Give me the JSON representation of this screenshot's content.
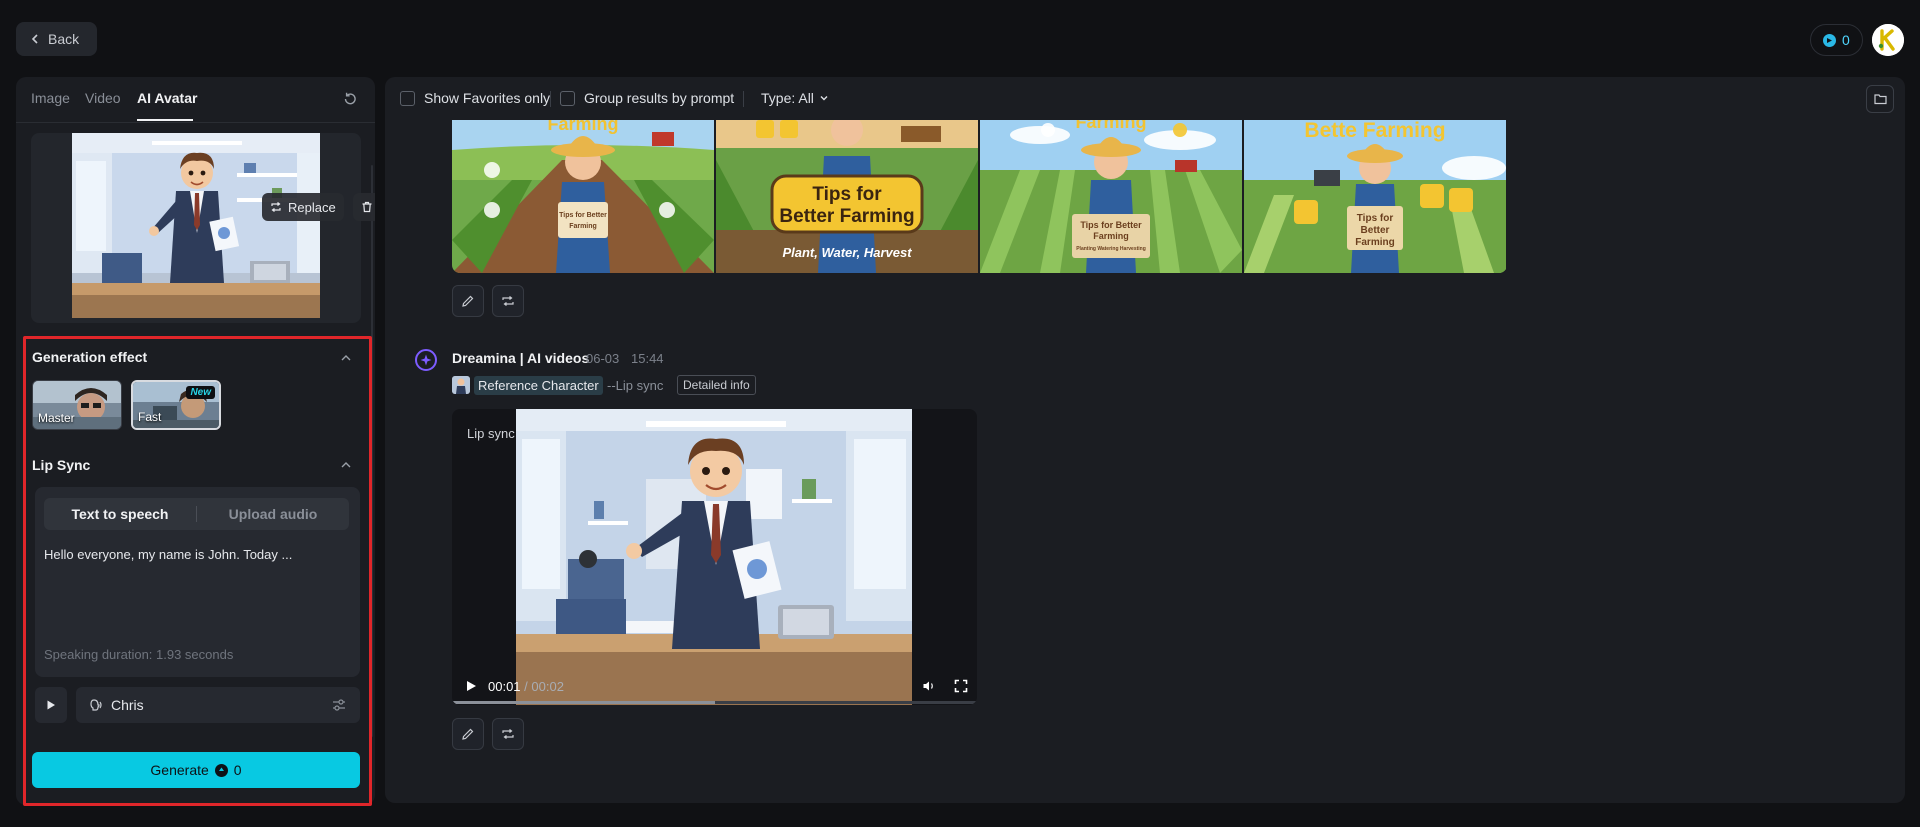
{
  "topbar": {
    "back_label": "Back",
    "credits": "0"
  },
  "left": {
    "tabs": [
      {
        "label": "Image"
      },
      {
        "label": "Video"
      },
      {
        "label": "AI Avatar"
      }
    ],
    "reference": {
      "replace_label": "Replace"
    },
    "generation_effect": {
      "title": "Generation effect",
      "options": [
        {
          "label": "Master"
        },
        {
          "label": "Fast",
          "badge": "New"
        }
      ]
    },
    "lip_sync": {
      "title": "Lip Sync",
      "modes": [
        {
          "label": "Text to speech"
        },
        {
          "label": "Upload audio"
        }
      ],
      "text": "Hello everyone, my name is John. Today ...",
      "duration": "Speaking duration: 1.93 seconds",
      "voice": "Chris"
    },
    "generate": {
      "label": "Generate",
      "cost": "0"
    }
  },
  "right": {
    "filters": {
      "favorites_label": "Show Favorites only",
      "group_label": "Group results by prompt",
      "type_label": "Type: All"
    },
    "images": [
      {
        "title_top": "Farming",
        "sign": "Tips for Better Farming"
      },
      {
        "title_top": "",
        "sign": "Tips for Better Farming",
        "sub": "Plant, Water, Harvest"
      },
      {
        "title_top": "Farming",
        "sign": "Tips for Better Farming",
        "sub": "Planting Watering Harvesting"
      },
      {
        "title_top": "Bette Farming",
        "sign": "Tips for Better Farming"
      }
    ],
    "entry": {
      "title": "Dreamina | AI videos",
      "date": "06-03",
      "time": "15:44",
      "ref_label": "Reference Character",
      "tag": "--Lip sync",
      "detail_label": "Detailed info",
      "video_label": "Lip sync",
      "time_current": "00:01",
      "time_total": "/ 00:02",
      "progress": 0.5
    }
  },
  "colors": {
    "accent": "#08c9e2",
    "highlight": "#e0262a",
    "panel": "#1b1d22"
  }
}
